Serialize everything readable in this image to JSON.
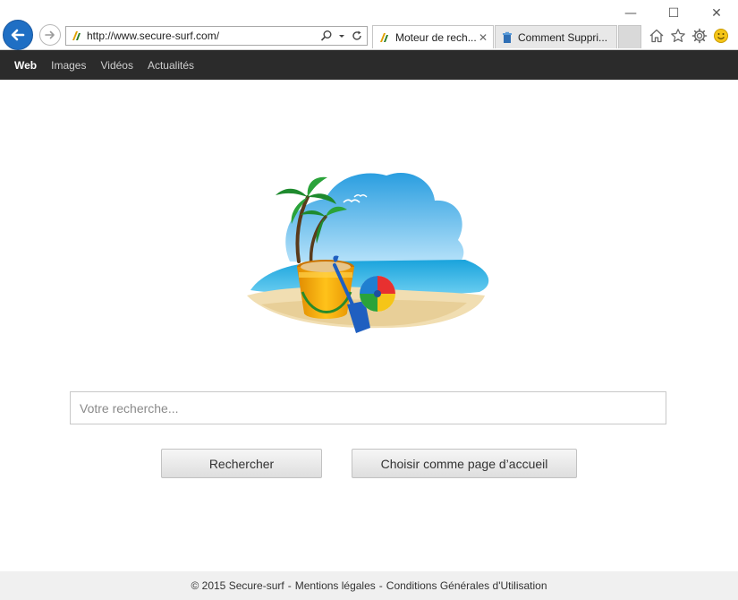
{
  "browser": {
    "url": "http://www.secure-surf.com/",
    "tabs": [
      {
        "label": "Moteur de rech...",
        "active": true
      },
      {
        "label": "Comment Suppri...",
        "active": false
      }
    ],
    "window_controls": {
      "minimize": "—",
      "maximize": "☐",
      "close": "✕"
    },
    "tab_close_glyph": "✕",
    "icons": [
      "back-arrow-icon",
      "forward-arrow-icon",
      "search-icon",
      "dropdown-icon",
      "refresh-icon",
      "home-icon",
      "favorites-star-icon",
      "settings-gear-icon",
      "smiley-icon"
    ]
  },
  "nav": {
    "items": [
      {
        "label": "Web",
        "active": true
      },
      {
        "label": "Images",
        "active": false
      },
      {
        "label": "Vidéos",
        "active": false
      },
      {
        "label": "Actualités",
        "active": false
      }
    ]
  },
  "main": {
    "hero_image": "beach-illustration",
    "search": {
      "placeholder": "Votre recherche...",
      "value": ""
    },
    "search_button": "Rechercher",
    "homepage_button": "Choisir comme page d’accueil"
  },
  "footer": {
    "copyright": "© 2015 Secure-surf",
    "separator": "-",
    "mentions": "Mentions légales",
    "terms": "Conditions Générales d'Utilisation"
  },
  "colors": {
    "accent": "#1f6fc4",
    "nav_bg": "#2b2b2b",
    "footer_bg": "#f0f0f0"
  }
}
